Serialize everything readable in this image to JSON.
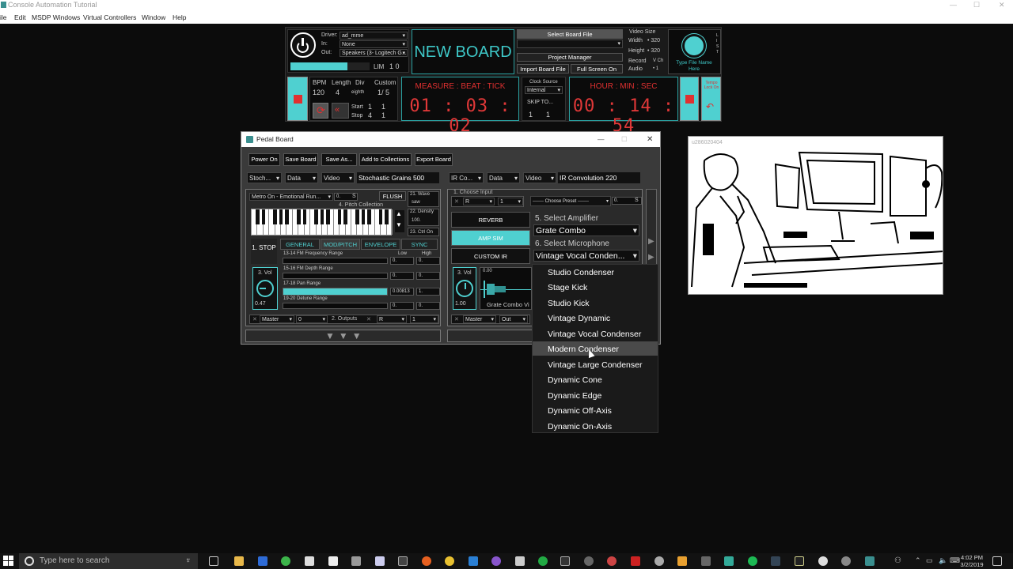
{
  "window": {
    "title": "Console Automation Tutorial"
  },
  "menu": [
    "ile",
    "Edit",
    "MSDP Windows",
    "Virtual Controllers",
    "Window",
    "Help"
  ],
  "transport": {
    "driver_label": "Driver:",
    "driver_value": "ad_mme",
    "in_label": "In:",
    "in_value": "None",
    "out_label": "Out:",
    "out_value": "Speakers (3- Logitech G...",
    "lim_label": "LIM",
    "lim_value": "1 0",
    "board_name": "NEW BOARD",
    "select_board": "Select Board File",
    "project_manager": "Project Manager",
    "import_board": "Import Board File",
    "full_screen": "Full Screen On",
    "video_size": "Video Size",
    "width_label": "Width",
    "width_value": "• 320",
    "height_label": "Height",
    "height_value": "• 320",
    "record_label": "Record",
    "record_value": "V Ch",
    "audio_label": "Audio",
    "audio_value": "• 1",
    "type_file_name": "Type File Name Here",
    "list_label": "L I S T",
    "bpm_label": "BPM",
    "bpm_value": "120",
    "length_label": "Length",
    "length_value": "4",
    "div_label": "Div",
    "div_value": "eighth",
    "custom_label": "Custom",
    "custom_value": "1/ 5",
    "start_label": "Start",
    "start_a": "1",
    "start_b": "1",
    "stop_label": "Stop",
    "stop_a": "4",
    "stop_b": "1",
    "measure_header": "MEASURE  :  BEAT  :  TICK",
    "measure_value": "01 : 03 : 02",
    "clock_source_label": "Clock Source",
    "clock_source_value": "Internal",
    "skip_to_label": "SKIP TO...",
    "skip_a": "1",
    "skip_b": "1",
    "time_header": "HOUR  :  MIN  :  SEC",
    "time_value": "00 : 14 : 54",
    "tempo_note": "Tempo Lock On"
  },
  "pedal": {
    "title": "Pedal Board",
    "toolbar": [
      "Power On",
      "Save Board",
      "Save As...",
      "Add to Collections",
      "Export Board"
    ],
    "left_sel1": "Stoch...",
    "left_sel2": "Data",
    "left_sel3": "Video",
    "left_name": "Stochastic Grains 500",
    "right_sel1": "IR Co...",
    "right_sel2": "Data",
    "right_sel3": "Video",
    "right_name": "IR Convolution 220",
    "metro": "Metro On - Emotional Run...",
    "metro_num": "0.",
    "metro_s": "S",
    "flush": "FLUSH",
    "wave_label": "21. Wave",
    "wave_value": "saw",
    "pitch_collection": "4. Pitch Collection",
    "density_label": "22. Density",
    "density_value": "100.",
    "ctrl_on": "23. Ctrl On",
    "stop_label": "1. STOP",
    "tabs": [
      "GENERAL",
      "MOD/PITCH",
      "ENVELOPE",
      "SYNC"
    ],
    "low": "Low",
    "high": "High",
    "rows": [
      {
        "label": "13-14 FM Frequency Range",
        "a": "0.",
        "b": "0."
      },
      {
        "label": "15-16 FM Depth Range",
        "a": "0.",
        "b": "0."
      },
      {
        "label": "17-18 Pan Range",
        "a": "0.00813",
        "b": "1."
      },
      {
        "label": "19-20 Detune Range",
        "a": "0.",
        "b": "0."
      }
    ],
    "vol_label": "3. Vol",
    "vol_value": "0.47",
    "master": "Master",
    "master_num": "0",
    "outputs": "2. Outputs",
    "out_r": "R",
    "out_num": "1",
    "choose_input": "1. Choose Input",
    "input_r": "R",
    "input_num": "1",
    "choose_preset": "------- Choose Preset -------",
    "preset_num": "0.",
    "preset_s": "S",
    "reverb": "REVERB",
    "amp_sim": "AMP SIM",
    "custom_ir": "CUSTOM IR",
    "select_amp": "5. Select Amplifier",
    "amp_value": "Grate Combo",
    "select_mic": "6. Select Microphone",
    "mic_value": "Vintage Vocal Conden...",
    "rvol_label": "3. Vol",
    "rvol_value": "1.00",
    "wave_val": "0.00",
    "wave_caption": "Grate Combo Vi",
    "rmaster": "Master",
    "rout": "Out"
  },
  "mic_options": [
    "Studio Condenser",
    "Stage Kick",
    "Studio Kick",
    "Vintage Dynamic",
    "Vintage Vocal Condenser",
    "Modern Condenser",
    "Vintage Large Condenser",
    "Dynamic Cone",
    "Dynamic Edge",
    "Dynamic Off-Axis",
    "Dynamic On-Axis"
  ],
  "mic_highlighted": "Modern Condenser",
  "webcam": {
    "label": "u286020404"
  },
  "taskbar": {
    "search_placeholder": "Type here to search",
    "time": "4:02 PM",
    "date": "3/2/2019"
  },
  "colors": {
    "teal": "#3ec8c8",
    "red": "#e03030",
    "highlight": "#4a4a4a"
  }
}
